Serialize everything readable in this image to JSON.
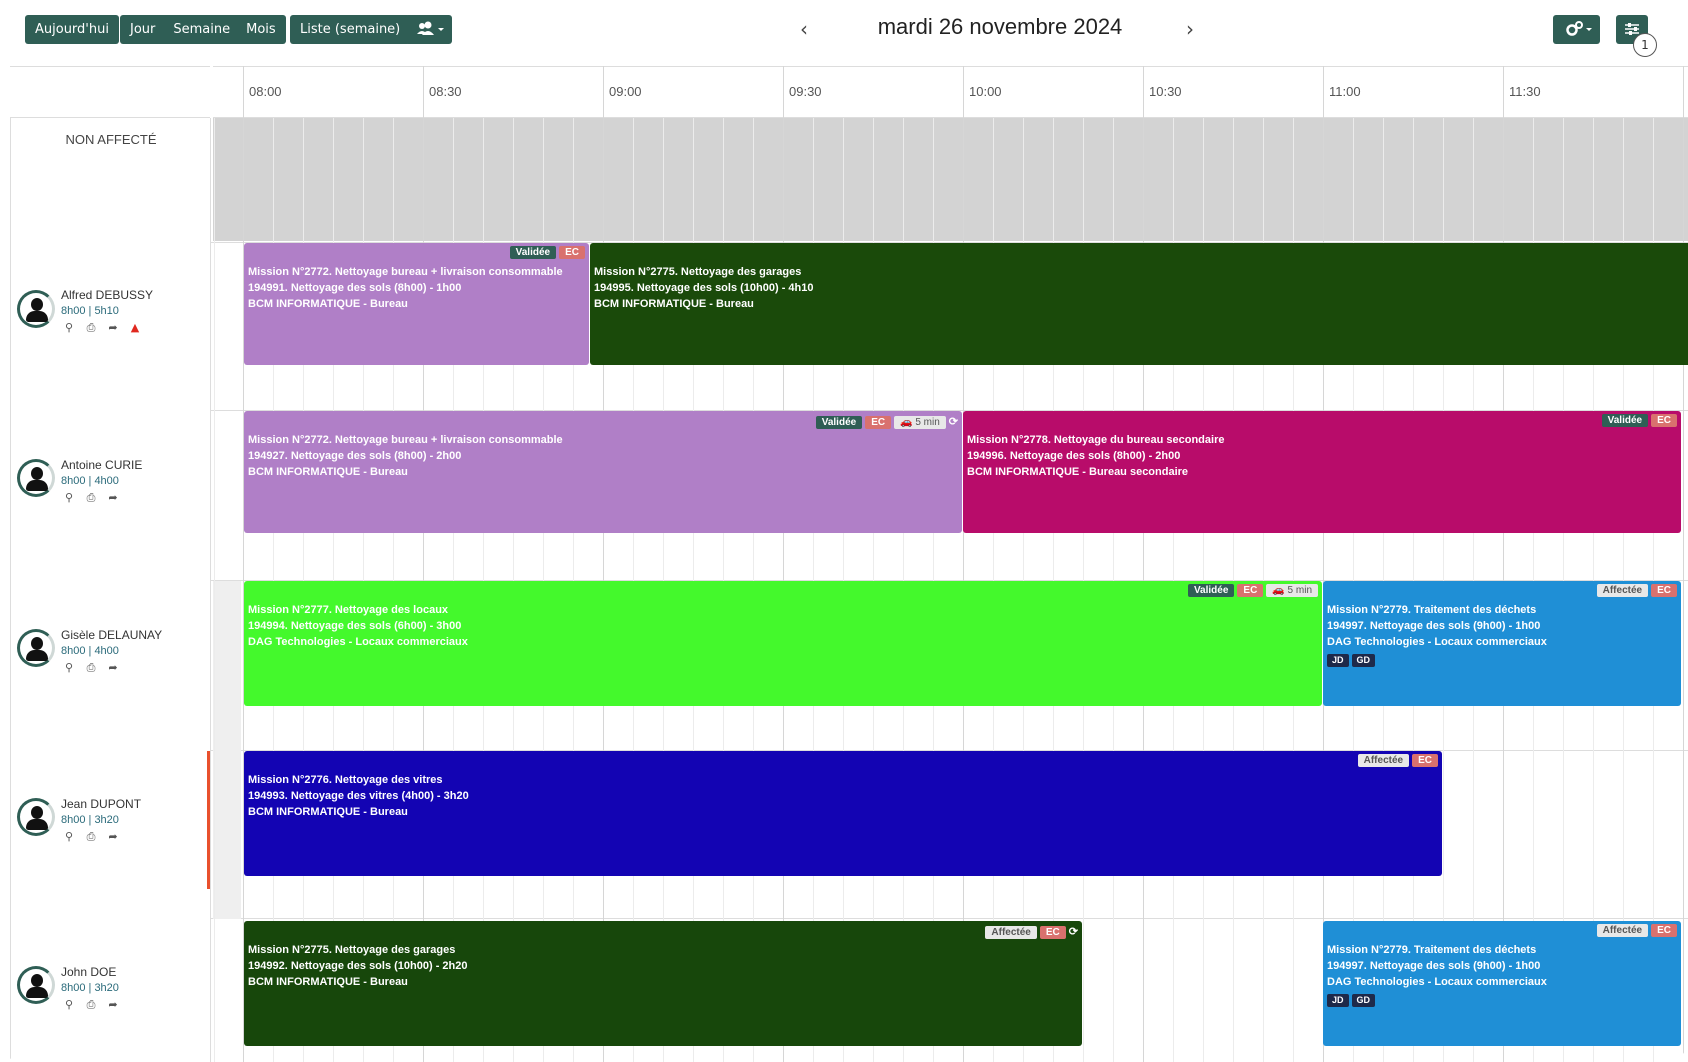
{
  "toolbar": {
    "today": "Aujourd'hui",
    "day": "Jour",
    "week": "Semaine",
    "month": "Mois",
    "list_week": "Liste (semaine)",
    "users_icon": "users-icon",
    "prev": "‹",
    "next": "›",
    "date_title": "mardi 26 novembre 2024",
    "settings_icon": "cogs-icon",
    "filter_icon": "sliders-icon",
    "filter_count": "1"
  },
  "time_slots": [
    "08:00",
    "08:30",
    "09:00",
    "09:30",
    "10:00",
    "10:30",
    "11:00",
    "11:30"
  ],
  "unassigned_label": "NON AFFECTÉ",
  "resources": [
    {
      "name": "Alfred DEBUSSY",
      "hours": "8h00 | 5h10",
      "warning": true
    },
    {
      "name": "Antoine CURIE",
      "hours": "8h00 | 4h00",
      "warning": false
    },
    {
      "name": "Gisèle DELAUNAY",
      "hours": "8h00 | 4h00",
      "warning": false
    },
    {
      "name": "Jean DUPONT",
      "hours": "8h00 | 3h20",
      "warning": false
    },
    {
      "name": "John DOE",
      "hours": "8h00 | 3h20",
      "warning": false
    }
  ],
  "resource_icons": [
    "map-marker-icon",
    "print-icon",
    "share-icon"
  ],
  "events": [
    {
      "row": 0,
      "color": "#b07fc7",
      "lines": [
        "Mission N°2772. Nettoyage bureau + livraison consommable",
        "194991. Nettoyage des sols (8h00) - 1h00",
        "BCM INFORMATIQUE - Bureau"
      ],
      "status": "Validée",
      "ec": "EC"
    },
    {
      "row": 0,
      "color": "#1a4a0a",
      "lines": [
        "Mission N°2775. Nettoyage des garages",
        "194995. Nettoyage des sols (10h00) - 4h10",
        "BCM INFORMATIQUE - Bureau"
      ]
    },
    {
      "row": 1,
      "color": "#b07fc7",
      "lines": [
        "Mission N°2772. Nettoyage bureau + livraison consommable",
        "194927. Nettoyage des sols (8h00) - 2h00",
        "BCM INFORMATIQUE - Bureau"
      ],
      "status": "Validée",
      "ec": "EC",
      "travel": "5 min"
    },
    {
      "row": 1,
      "color": "#b80c6a",
      "lines": [
        "Mission N°2778. Nettoyage du bureau secondaire",
        "194996. Nettoyage des sols (8h00) - 2h00",
        "BCM INFORMATIQUE - Bureau secondaire"
      ],
      "status": "Validée",
      "ec": "EC"
    },
    {
      "row": 2,
      "color": "#44f92c",
      "lines": [
        "Mission N°2777. Nettoyage des locaux",
        "194994. Nettoyage des sols (6h00) - 3h00",
        "DAG Technologies - Locaux commerciaux"
      ],
      "status": "Validée",
      "ec": "EC",
      "travel": "5 min"
    },
    {
      "row": 2,
      "color": "#1f8fd6",
      "lines": [
        "Mission N°2779. Traitement des déchets",
        "194997. Nettoyage des sols (9h00) - 1h00",
        "DAG Technologies - Locaux commerciaux"
      ],
      "status": "Affectée",
      "ec": "EC",
      "initials": [
        "JD",
        "GD"
      ]
    },
    {
      "row": 3,
      "color": "#1304b3",
      "lines": [
        "Mission N°2776. Nettoyage des vitres",
        "194993. Nettoyage des vitres (4h00) - 3h20",
        "BCM INFORMATIQUE - Bureau"
      ],
      "status": "Affectée",
      "ec": "EC"
    },
    {
      "row": 4,
      "color": "#17470b",
      "lines": [
        "Mission N°2775. Nettoyage des garages",
        "194992. Nettoyage des sols (10h00) - 2h20",
        "BCM INFORMATIQUE - Bureau"
      ],
      "status": "Affectée",
      "ec": "EC"
    },
    {
      "row": 4,
      "color": "#1f8fd6",
      "lines": [
        "Mission N°2779. Traitement des déchets",
        "194997. Nettoyage des sols (9h00) - 1h00",
        "DAG Technologies - Locaux commerciaux"
      ],
      "status": "Affectée",
      "ec": "EC",
      "initials": [
        "JD",
        "GD"
      ]
    }
  ]
}
